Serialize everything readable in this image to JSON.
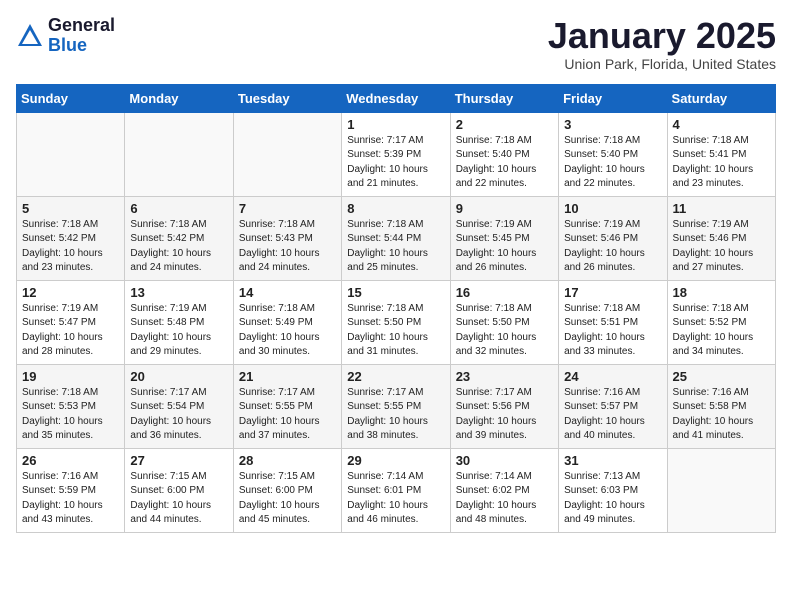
{
  "header": {
    "logo_general": "General",
    "logo_blue": "Blue",
    "month_title": "January 2025",
    "location": "Union Park, Florida, United States"
  },
  "days_of_week": [
    "Sunday",
    "Monday",
    "Tuesday",
    "Wednesday",
    "Thursday",
    "Friday",
    "Saturday"
  ],
  "weeks": [
    [
      {
        "day": "",
        "info": ""
      },
      {
        "day": "",
        "info": ""
      },
      {
        "day": "",
        "info": ""
      },
      {
        "day": "1",
        "info": "Sunrise: 7:17 AM\nSunset: 5:39 PM\nDaylight: 10 hours\nand 21 minutes."
      },
      {
        "day": "2",
        "info": "Sunrise: 7:18 AM\nSunset: 5:40 PM\nDaylight: 10 hours\nand 22 minutes."
      },
      {
        "day": "3",
        "info": "Sunrise: 7:18 AM\nSunset: 5:40 PM\nDaylight: 10 hours\nand 22 minutes."
      },
      {
        "day": "4",
        "info": "Sunrise: 7:18 AM\nSunset: 5:41 PM\nDaylight: 10 hours\nand 23 minutes."
      }
    ],
    [
      {
        "day": "5",
        "info": "Sunrise: 7:18 AM\nSunset: 5:42 PM\nDaylight: 10 hours\nand 23 minutes."
      },
      {
        "day": "6",
        "info": "Sunrise: 7:18 AM\nSunset: 5:42 PM\nDaylight: 10 hours\nand 24 minutes."
      },
      {
        "day": "7",
        "info": "Sunrise: 7:18 AM\nSunset: 5:43 PM\nDaylight: 10 hours\nand 24 minutes."
      },
      {
        "day": "8",
        "info": "Sunrise: 7:18 AM\nSunset: 5:44 PM\nDaylight: 10 hours\nand 25 minutes."
      },
      {
        "day": "9",
        "info": "Sunrise: 7:19 AM\nSunset: 5:45 PM\nDaylight: 10 hours\nand 26 minutes."
      },
      {
        "day": "10",
        "info": "Sunrise: 7:19 AM\nSunset: 5:46 PM\nDaylight: 10 hours\nand 26 minutes."
      },
      {
        "day": "11",
        "info": "Sunrise: 7:19 AM\nSunset: 5:46 PM\nDaylight: 10 hours\nand 27 minutes."
      }
    ],
    [
      {
        "day": "12",
        "info": "Sunrise: 7:19 AM\nSunset: 5:47 PM\nDaylight: 10 hours\nand 28 minutes."
      },
      {
        "day": "13",
        "info": "Sunrise: 7:19 AM\nSunset: 5:48 PM\nDaylight: 10 hours\nand 29 minutes."
      },
      {
        "day": "14",
        "info": "Sunrise: 7:18 AM\nSunset: 5:49 PM\nDaylight: 10 hours\nand 30 minutes."
      },
      {
        "day": "15",
        "info": "Sunrise: 7:18 AM\nSunset: 5:50 PM\nDaylight: 10 hours\nand 31 minutes."
      },
      {
        "day": "16",
        "info": "Sunrise: 7:18 AM\nSunset: 5:50 PM\nDaylight: 10 hours\nand 32 minutes."
      },
      {
        "day": "17",
        "info": "Sunrise: 7:18 AM\nSunset: 5:51 PM\nDaylight: 10 hours\nand 33 minutes."
      },
      {
        "day": "18",
        "info": "Sunrise: 7:18 AM\nSunset: 5:52 PM\nDaylight: 10 hours\nand 34 minutes."
      }
    ],
    [
      {
        "day": "19",
        "info": "Sunrise: 7:18 AM\nSunset: 5:53 PM\nDaylight: 10 hours\nand 35 minutes."
      },
      {
        "day": "20",
        "info": "Sunrise: 7:17 AM\nSunset: 5:54 PM\nDaylight: 10 hours\nand 36 minutes."
      },
      {
        "day": "21",
        "info": "Sunrise: 7:17 AM\nSunset: 5:55 PM\nDaylight: 10 hours\nand 37 minutes."
      },
      {
        "day": "22",
        "info": "Sunrise: 7:17 AM\nSunset: 5:55 PM\nDaylight: 10 hours\nand 38 minutes."
      },
      {
        "day": "23",
        "info": "Sunrise: 7:17 AM\nSunset: 5:56 PM\nDaylight: 10 hours\nand 39 minutes."
      },
      {
        "day": "24",
        "info": "Sunrise: 7:16 AM\nSunset: 5:57 PM\nDaylight: 10 hours\nand 40 minutes."
      },
      {
        "day": "25",
        "info": "Sunrise: 7:16 AM\nSunset: 5:58 PM\nDaylight: 10 hours\nand 41 minutes."
      }
    ],
    [
      {
        "day": "26",
        "info": "Sunrise: 7:16 AM\nSunset: 5:59 PM\nDaylight: 10 hours\nand 43 minutes."
      },
      {
        "day": "27",
        "info": "Sunrise: 7:15 AM\nSunset: 6:00 PM\nDaylight: 10 hours\nand 44 minutes."
      },
      {
        "day": "28",
        "info": "Sunrise: 7:15 AM\nSunset: 6:00 PM\nDaylight: 10 hours\nand 45 minutes."
      },
      {
        "day": "29",
        "info": "Sunrise: 7:14 AM\nSunset: 6:01 PM\nDaylight: 10 hours\nand 46 minutes."
      },
      {
        "day": "30",
        "info": "Sunrise: 7:14 AM\nSunset: 6:02 PM\nDaylight: 10 hours\nand 48 minutes."
      },
      {
        "day": "31",
        "info": "Sunrise: 7:13 AM\nSunset: 6:03 PM\nDaylight: 10 hours\nand 49 minutes."
      },
      {
        "day": "",
        "info": ""
      }
    ]
  ]
}
